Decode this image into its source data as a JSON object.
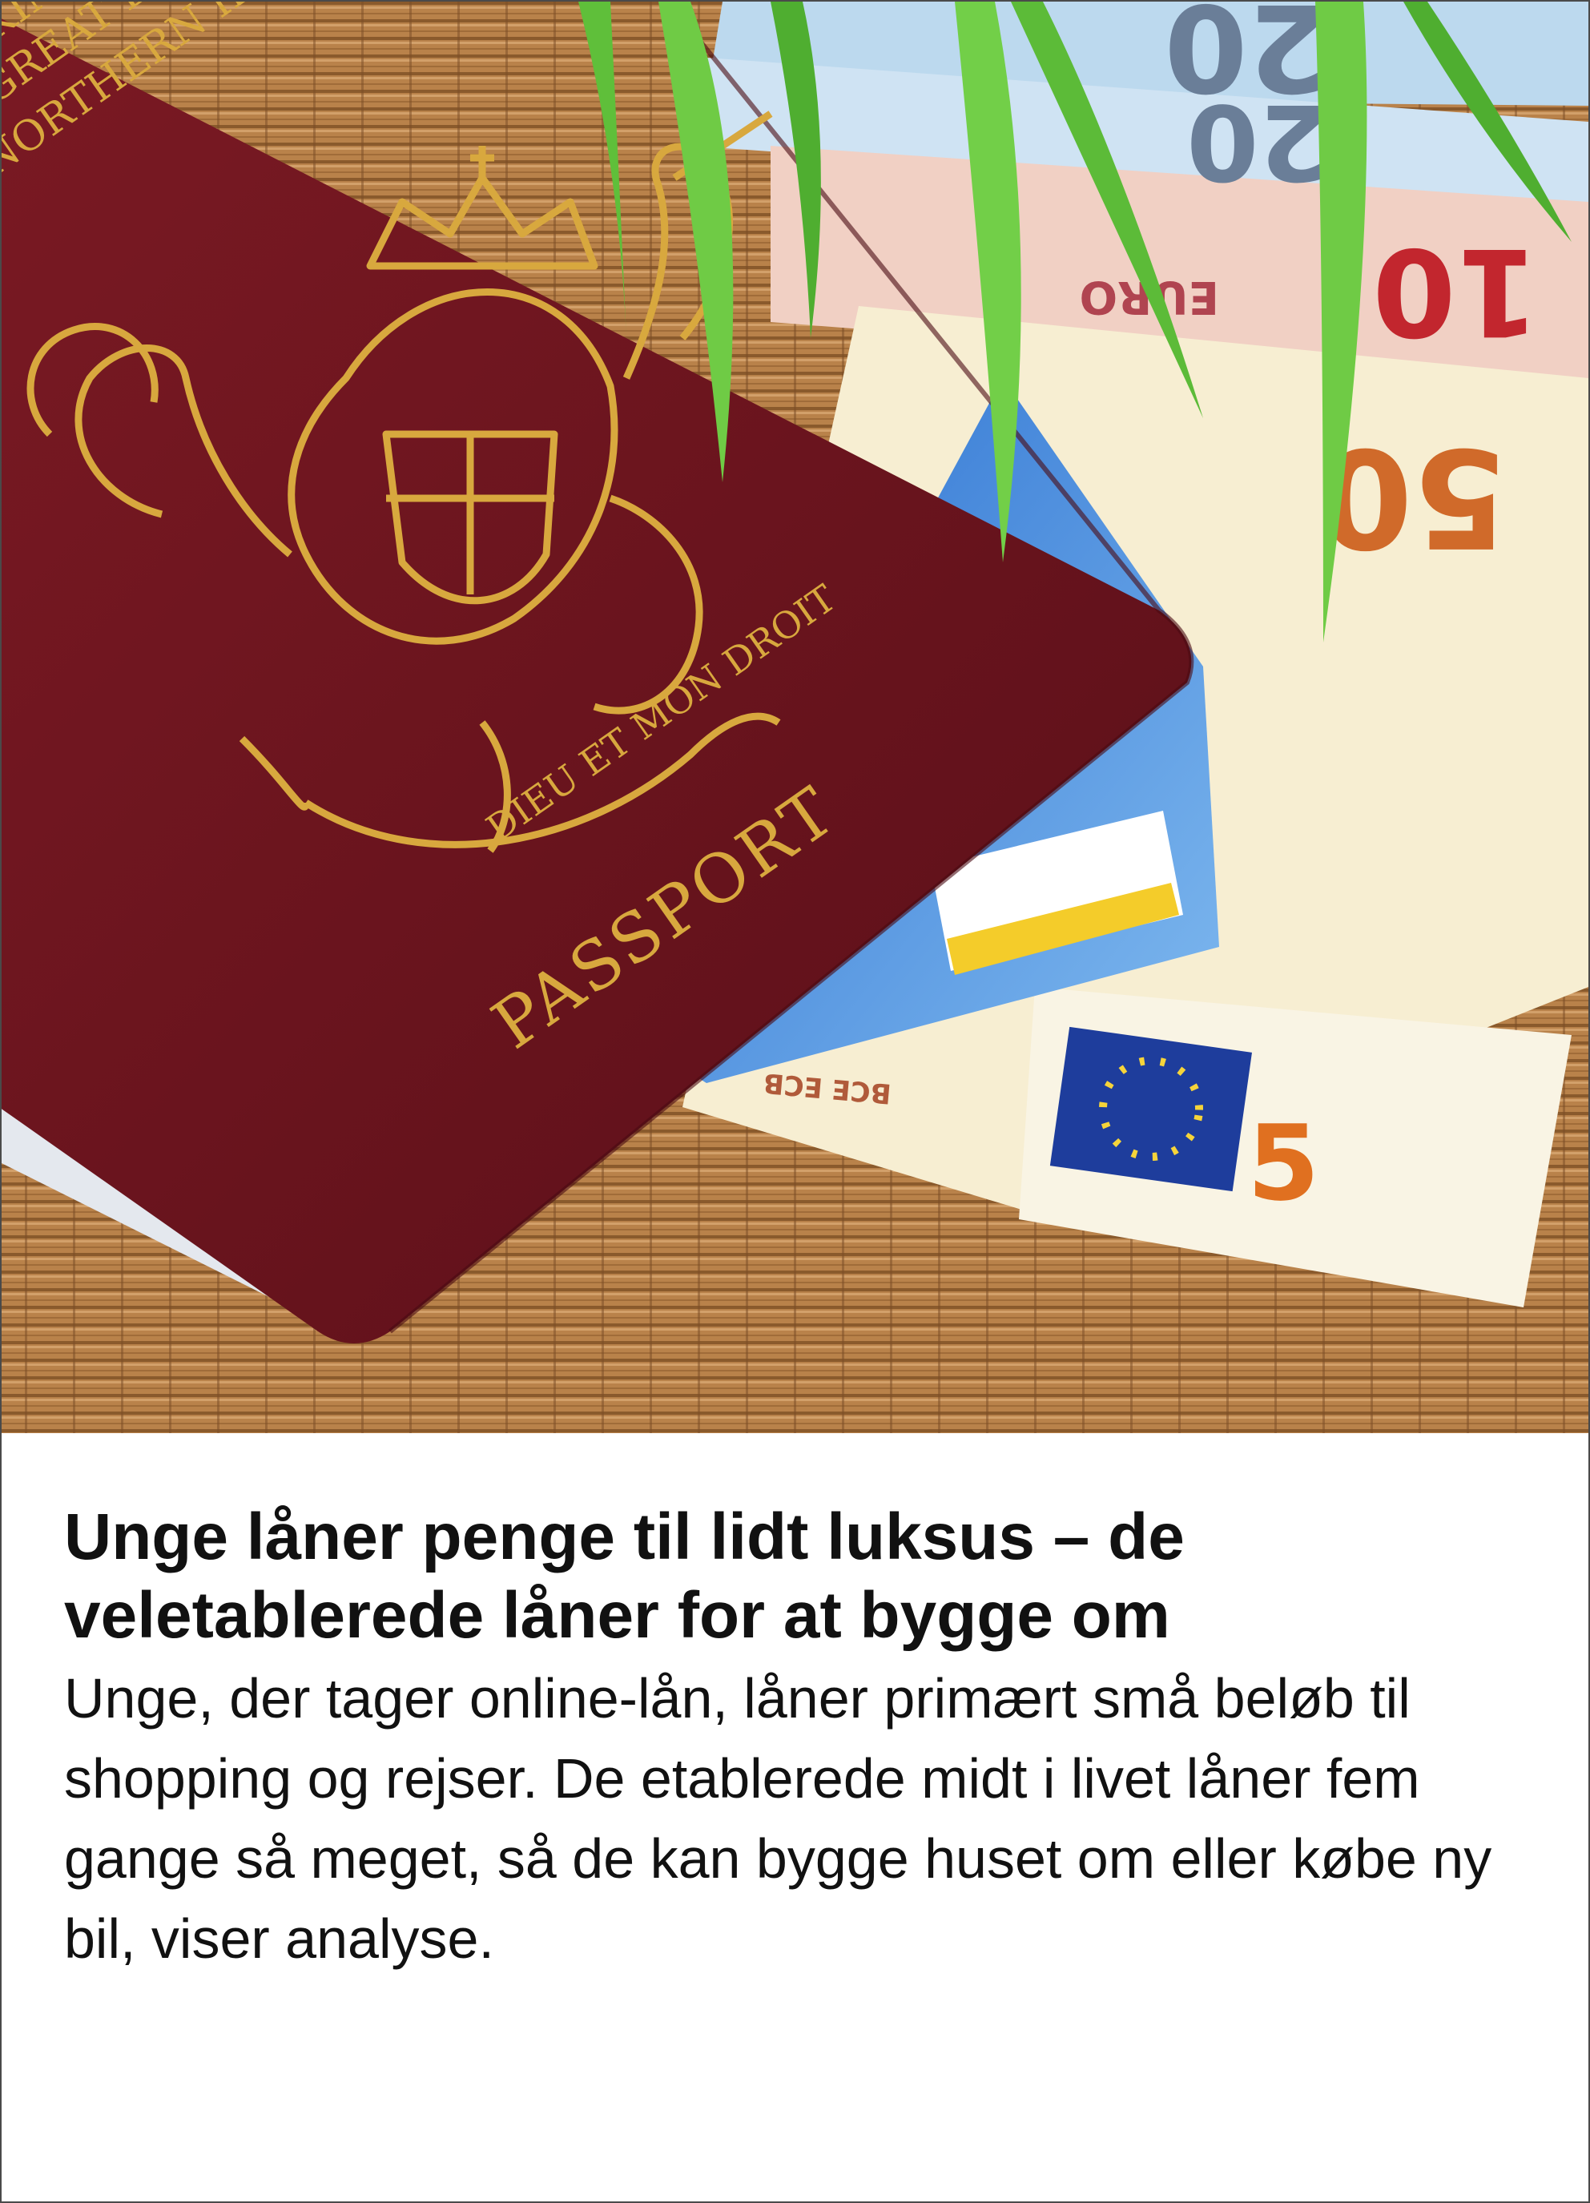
{
  "article": {
    "headline": "Unge låner penge til lidt luksus – de veletablerede låner for at bygge om",
    "summary": "Unge, der tager online-lån, låner primært små beløb til shopping og rejser. De etablerede midt i livet låner fem gange så meget, så de kan bygge huset om eller købe ny bil, viser analyse."
  },
  "image": {
    "passport_cover_text": "PASSPORT",
    "passport_header_lines": [
      "KINGDOM",
      "GREAT BRITAIN",
      "NORTHERN IRELAND"
    ],
    "crest_motto": "DIEU ET MON DROIT",
    "banknote_denominations": [
      "20",
      "20",
      "10",
      "50",
      "5"
    ],
    "banknote_word": "EURO",
    "banknote_initials": "BCE ECB",
    "colors": {
      "passport": "#6e1520",
      "gold": "#d8a83e",
      "mat": "#b9824a",
      "leaf": "#5fbf3a"
    }
  }
}
